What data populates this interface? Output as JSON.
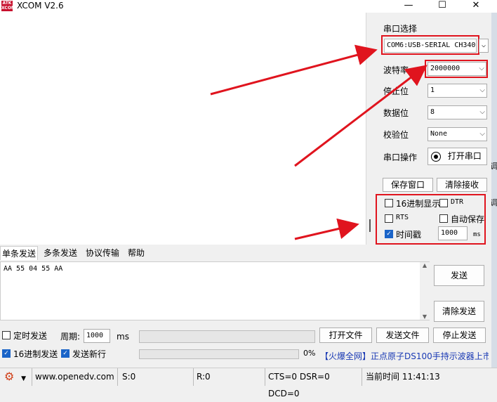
{
  "window": {
    "title": "XCOM V2.6",
    "logo_text": "ATK XCOM",
    "minimize": "—",
    "maximize": "☐",
    "close": "✕"
  },
  "right_panel": {
    "port_group_label": "串口选择",
    "port_value": "COM6:USB-SERIAL CH340",
    "baud_label": "波特率",
    "baud_value": "2000000",
    "stop_label": "停止位",
    "stop_value": "1",
    "data_label": "数据位",
    "data_value": "8",
    "parity_label": "校验位",
    "parity_value": "None",
    "op_label": "串口操作",
    "open_port_label": "打开串口",
    "save_window_label": "保存窗口",
    "clear_recv_label": "清除接收",
    "hex_display_label": "16进制显示",
    "dtr_label": "DTR",
    "rts_label": "RTS",
    "auto_save_label": "自动保存",
    "timestamp_label": "时间戳",
    "timestamp_value": "1000",
    "timestamp_unit": "ms"
  },
  "tabs": [
    "单条发送",
    "多条发送",
    "协议传输",
    "帮助"
  ],
  "send": {
    "text": "AA 55 04 55 AA",
    "send_label": "发送",
    "clear_send_label": "清除发送"
  },
  "bottom": {
    "timed_send_label": "定时发送",
    "period_label": "周期:",
    "period_value": "1000",
    "period_unit": "ms",
    "open_file_label": "打开文件",
    "send_file_label": "发送文件",
    "stop_send_label": "停止发送",
    "hex_send_label": "16进制发送",
    "send_newline_label": "发送新行",
    "progress_pct": "0%",
    "progress_value": 0,
    "ad_link": "【火爆全网】正点原子DS100手持示波器上市"
  },
  "statusbar": {
    "website": "www.openedv.com",
    "sent": "S:0",
    "received": "R:0",
    "signals": "CTS=0 DSR=0 DCD=0",
    "time": "当前时间 11:41:13"
  },
  "edge": {
    "text1": "调",
    "text2": "调",
    "text3": "码"
  },
  "colors": {
    "highlight": "#e0141e",
    "accent": "#1a64c8"
  }
}
